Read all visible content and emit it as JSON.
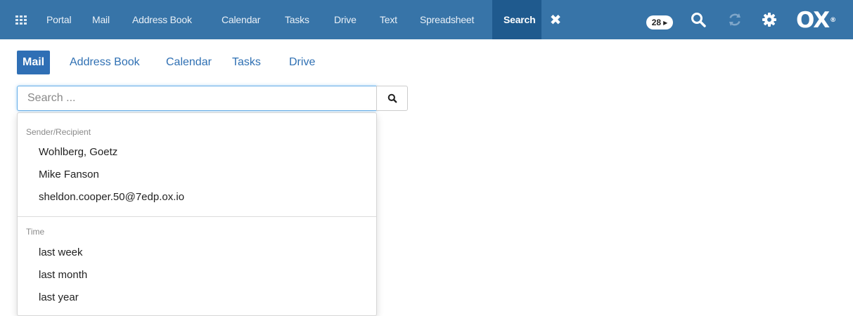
{
  "topbar": {
    "apps": [
      {
        "label": "Portal"
      },
      {
        "label": "Mail"
      },
      {
        "label": "Address Book"
      },
      {
        "label": "Calendar"
      },
      {
        "label": "Tasks"
      },
      {
        "label": "Drive"
      },
      {
        "label": "Text"
      },
      {
        "label": "Spreadsheet"
      },
      {
        "label": "Search"
      }
    ],
    "close_symbol": "✖",
    "notification_count": "28",
    "logo": "OX"
  },
  "modules": {
    "tabs": [
      {
        "label": "Mail"
      },
      {
        "label": "Address Book"
      },
      {
        "label": "Calendar"
      },
      {
        "label": "Tasks"
      },
      {
        "label": "Drive"
      }
    ]
  },
  "search": {
    "placeholder": "Search ..."
  },
  "dropdown": {
    "sections": [
      {
        "title": "Sender/Recipient",
        "items": [
          "Wohlberg, Goetz",
          "Mike Fanson",
          "sheldon.cooper.50@7edp.ox.io"
        ]
      },
      {
        "title": "Time",
        "items": [
          "last week",
          "last month",
          "last year"
        ]
      }
    ]
  },
  "colors": {
    "topbar": "#3774a8",
    "active_app": "#1f5a8e",
    "accent": "#2f6fb5"
  }
}
